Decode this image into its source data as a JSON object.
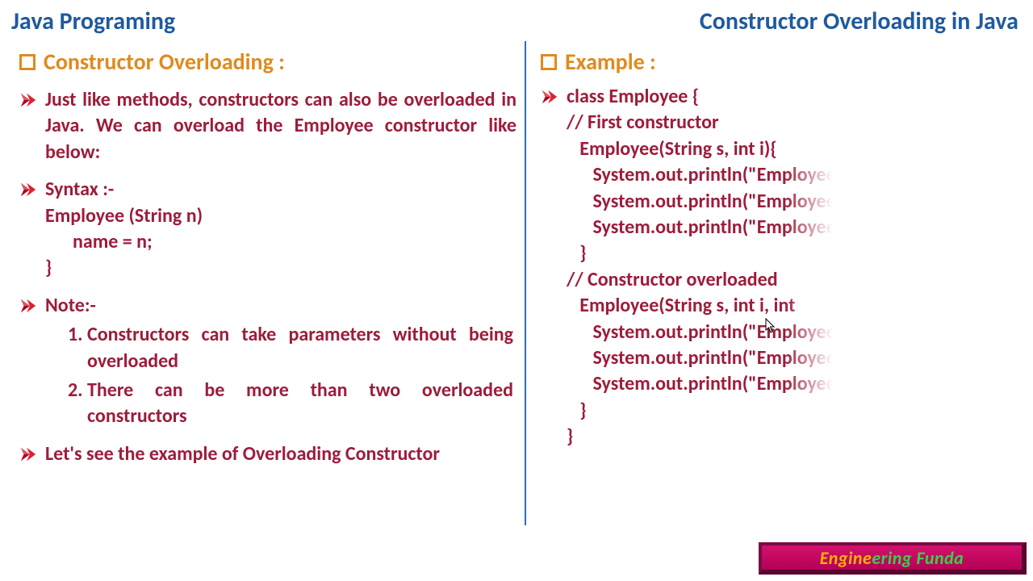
{
  "header": {
    "left": "Java Programing",
    "right": "Constructor Overloading in Java"
  },
  "left": {
    "section_title": "Constructor Overloading :",
    "p1": "Just like methods, constructors can also be overloaded in Java. We can overload the Employee constructor like below:",
    "syntax_label": "Syntax :-",
    "syntax_l1": "Employee (String n)",
    "syntax_l2": "name = n;",
    "syntax_l3": "}",
    "note_label": "Note:-",
    "note1": "Constructors can take parameters without being overloaded",
    "note2": "There can be more than two overloaded constructors",
    "p2": "Let's see the example of Overloading Constructor"
  },
  "right": {
    "section_title": "Example :",
    "code": {
      "l01": "class Employee {",
      "l02": "// First constructor",
      "l03": "   Employee(String s, int i){",
      "l04": "      System.out.println(\"Employee",
      "l05": "      System.out.println(\"Employee",
      "l06": "      System.out.println(\"Employee",
      "l07": "   }",
      "l08": "// Constructor overloaded",
      "l09": "   Employee(String s, int i, int",
      "l10": "      System.out.println(\"Employee",
      "l11": "      System.out.println(\"Employee",
      "l12": "      System.out.println(\"Employee",
      "l13": "   }",
      "l14": "}"
    }
  },
  "brand": {
    "p1": "Engine",
    "p2": "ering Funda"
  }
}
